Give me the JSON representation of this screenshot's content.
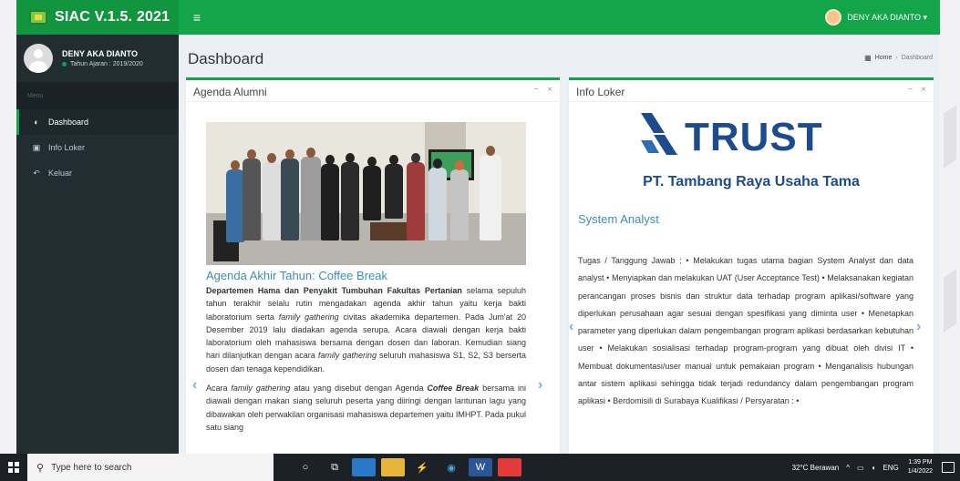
{
  "app": {
    "brand": "SIAC V.1.5. 2021",
    "top_user": "DENY AKA DIANTO ▾"
  },
  "sidebar": {
    "user_name": "DENY AKA DIANTO",
    "user_status": "Tahun Ajaran : 2019/2020",
    "menu_header": "Menu",
    "items": [
      {
        "icon": "dashboard-icon",
        "label": "Dashboard"
      },
      {
        "icon": "id-card-icon",
        "label": "Info Loker"
      },
      {
        "icon": "reply-icon",
        "label": "Keluar"
      }
    ]
  },
  "header": {
    "title": "Dashboard",
    "breadcrumb_home": "Home",
    "breadcrumb_current": "Dashboard"
  },
  "agenda": {
    "box_title": "Agenda Alumni",
    "heading": "Agenda Akhir Tahun: Coffee Break",
    "p1_bold": "Departemen Hama dan Penyakit Tumbuhan Fakultas Pertanian",
    "p1_a": " selama sepuluh tahun terakhir selalu rutin mengadakan agenda akhir tahun yaitu kerja bakti laboratorium serta ",
    "p1_i1": "family gathering",
    "p1_b": " civitas akademika departemen. Pada Jum'at 20 Desember 2019 lalu diadakan agenda serupa. Acara diawali dengan kerja bakti laboratorium oleh mahasiswa bersama dengan dosen dan laboran. Kemudian siang hari dilanjutkan dengan acara ",
    "p1_i2": "family gathering",
    "p1_c": " seluruh mahasiswa S1, S2, S3 berserta dosen dan tenaga kependidikan.",
    "p2_a": "Acara ",
    "p2_i1": "family gathering",
    "p2_b": " atau yang disebut dengan Agenda ",
    "p2_bi": "Coffee Break",
    "p2_c": " bersama ini diawali dengan makan siang seluruh peserta yang diiringi dengan lantunan lagu yang dibawakan oleh perwakilan organisasi mahasiswa departemen yaitu IMHPT. Pada pukul satu siang"
  },
  "loker": {
    "box_title": "Info Loker",
    "logo_text": "TRUST",
    "company": "PT. Tambang Raya Usaha Tama",
    "job_title": "System Analyst",
    "description": "Tugas / Tanggung Jawab : • Melakukan tugas utama bagian System Analyst dan data analyst • Menyiapkan dan melakukan UAT (User Acceptance Test) • Melaksanakan kegiatan perancangan proses bisnis dan struktur data terhadap program aplikasi/software yang diperlukan perusahaan agar sesuai dengan spesifikasi yang diminta user • Menetapkan parameter yang diperlukan dalam pengembangan program aplikasi berdasarkan kebutuhan user • Melakukan sosialisasi terhadap program-program yang dibuat oleh divisi IT • Membuat dokumentasi/user manual untuk pemakaian program • Menganalisis hubungan antar sistem aplikasi sehingga tidak terjadi redundancy dalam pengembangan program aplikasi • Berdomisili di Surabaya Kualifikasi / Persyaratan : •"
  },
  "taskbar": {
    "search_placeholder": "Type here to search",
    "weather": "32°C Berawan",
    "lang": "ENG",
    "time": "1:39 PM",
    "date": "1/4/2022"
  }
}
